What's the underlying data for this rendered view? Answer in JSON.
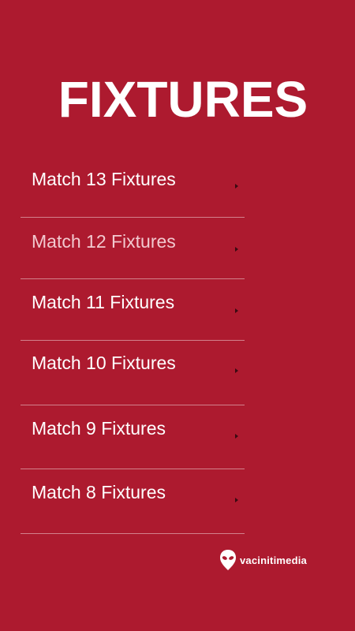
{
  "header": {
    "title": "FIXTURES"
  },
  "fixtures": [
    {
      "label": "Match 13 Fixtures"
    },
    {
      "label": "Match 12 Fixtures"
    },
    {
      "label": "Match 11 Fixtures"
    },
    {
      "label": "Match 10 Fixtures"
    },
    {
      "label": "Match 9 Fixtures"
    },
    {
      "label": "Match 8 Fixtures"
    }
  ],
  "footer": {
    "brand_name": "vacinitimedia",
    "brand_icon": "alien-head-icon"
  },
  "colors": {
    "background": "#ad1a2f",
    "text": "#ffffff",
    "divider": "#d9868f",
    "chevron": "#3a0a12"
  }
}
